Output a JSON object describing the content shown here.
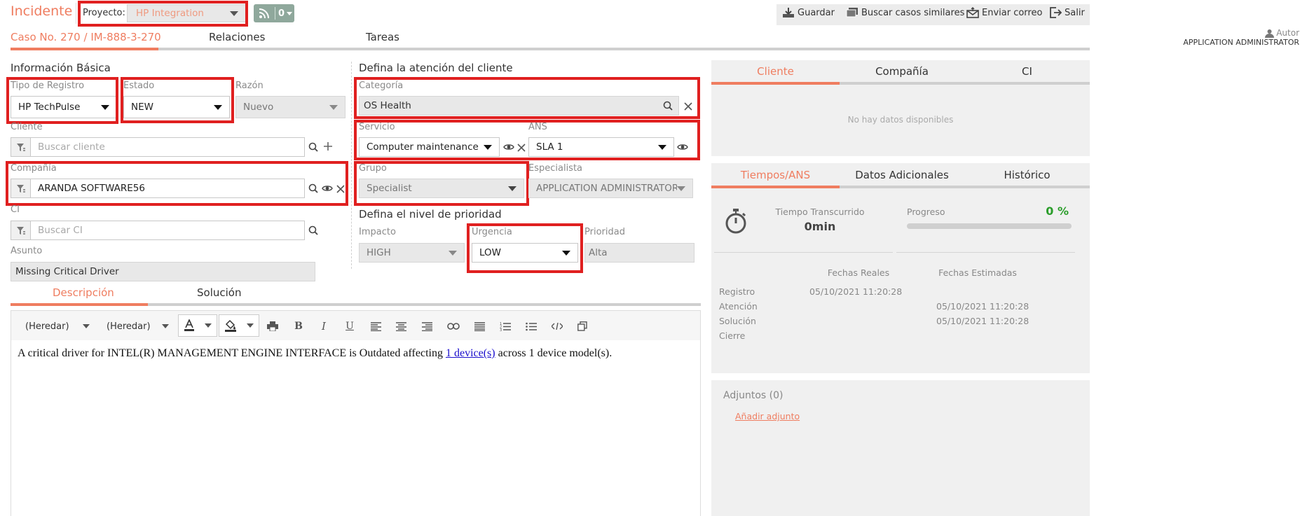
{
  "header": {
    "title": "Incidente",
    "project_label": "Proyecto:",
    "project_value": "HP Integration",
    "rss_count": "0",
    "actions": {
      "save": "Guardar",
      "similar": "Buscar casos similares",
      "email": "Enviar correo",
      "exit": "Salir"
    },
    "author_label": "Autor",
    "author_name": "APPLICATION ADMINISTRATOR"
  },
  "tabs": {
    "case": "Caso No. 270 / IM-888-3-270",
    "relations": "Relaciones",
    "tasks": "Tareas"
  },
  "basic": {
    "heading": "Información Básica",
    "record_type_label": "Tipo de Registro",
    "record_type": "HP TechPulse",
    "state_label": "Estado",
    "state": "NEW",
    "reason_label": "Razón",
    "reason": "Nuevo",
    "client_label": "Cliente",
    "client_placeholder": "Buscar cliente",
    "company_label": "Compañía",
    "company": "ARANDA SOFTWARE56",
    "ci_label": "CI",
    "ci_placeholder": "Buscar CI",
    "subject_label": "Asunto",
    "subject": "Missing Critical Driver"
  },
  "attention": {
    "heading": "Defina la atención del cliente",
    "category_label": "Categoría",
    "category": "OS Health",
    "service_label": "Servicio",
    "service": "Computer maintenance",
    "sla_label": "ANS",
    "sla": "SLA 1",
    "group_label": "Grupo",
    "group": "Specialist",
    "specialist_label": "Especialista",
    "specialist": "APPLICATION ADMINISTRATOR"
  },
  "priority": {
    "heading": "Defina el nivel de prioridad",
    "impact_label": "Impacto",
    "impact": "HIGH",
    "urgency_label": "Urgencia",
    "urgency": "LOW",
    "priority_label": "Prioridad",
    "priority": "Alta"
  },
  "desc_tabs": {
    "description": "Descripción",
    "solution": "Solución"
  },
  "editor": {
    "font_family": "(Heredar)",
    "font_size": "(Heredar)",
    "text_before": "A critical driver for INTEL(R) MANAGEMENT ENGINE INTERFACE is Outdated affecting ",
    "link": "1 device(s)",
    "text_after": " across 1 device model(s)."
  },
  "right_tabs": {
    "client": "Cliente",
    "company": "Compañía",
    "ci": "CI",
    "no_data": "No hay datos disponibles"
  },
  "times": {
    "tab_times": "Tiempos/ANS",
    "tab_additional": "Datos Adicionales",
    "tab_history": "Histórico",
    "elapsed_label": "Tiempo Transcurrido",
    "elapsed": "0min",
    "progress_label": "Progreso",
    "progress_text": "0 %",
    "progress": 0,
    "real_dates": "Fechas Reales",
    "estimated_dates": "Fechas Estimadas",
    "rows": [
      {
        "label": "Registro",
        "real": "05/10/2021 11:20:28",
        "est": ""
      },
      {
        "label": "Atención",
        "real": "",
        "est": "05/10/2021 11:20:28"
      },
      {
        "label": "Solución",
        "real": "",
        "est": "05/10/2021 11:20:28"
      },
      {
        "label": "Cierre",
        "real": "",
        "est": ""
      }
    ]
  },
  "attachments": {
    "title": "Adjuntos (0)",
    "add": "Añadir adjunto"
  },
  "colors": {
    "accent": "#ef7d60",
    "highlight": "#e02020",
    "success": "#2a9d2a"
  }
}
